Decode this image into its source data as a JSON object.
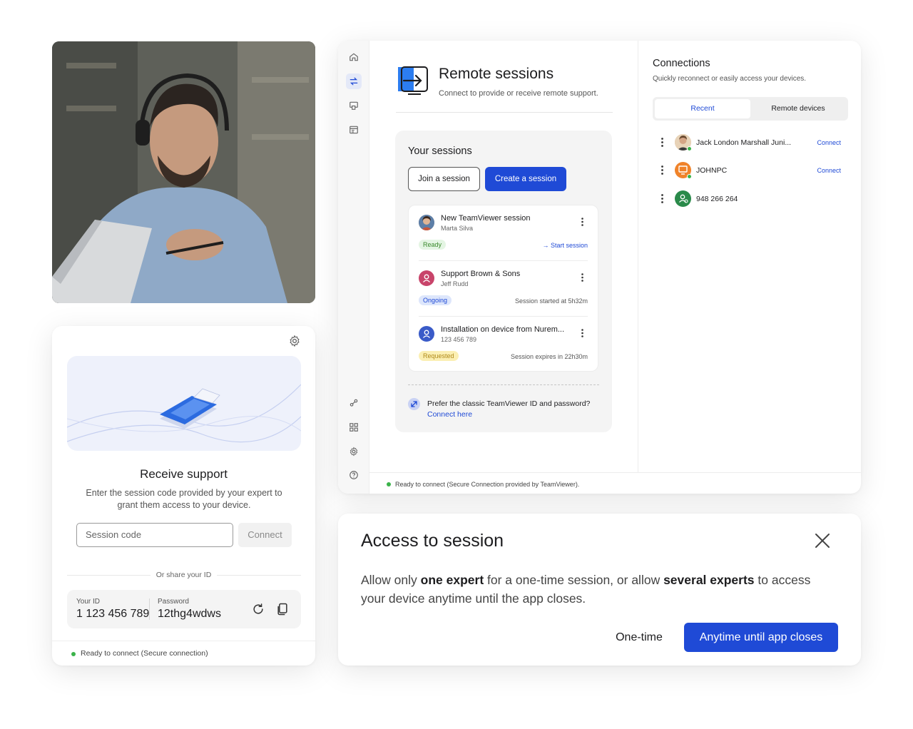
{
  "receive_support": {
    "title": "Receive support",
    "description": "Enter the session code provided by your expert to grant them access to your device.",
    "session_code_placeholder": "Session code",
    "connect_label": "Connect",
    "or_share": "Or share your ID",
    "your_id_label": "Your ID",
    "your_id_value": "1 123 456 789",
    "password_label": "Password",
    "password_value": "12thg4wdws",
    "status": "Ready to connect (Secure connection)"
  },
  "main": {
    "title": "Remote sessions",
    "subtitle": "Connect to provide or receive remote support.",
    "your_sessions": "Your sessions",
    "join_label": "Join a session",
    "create_label": "Create a session",
    "sessions": [
      {
        "name": "New TeamViewer session",
        "who": "Marta Silva",
        "badge": "Ready",
        "meta": "Start session"
      },
      {
        "name": "Support Brown & Sons",
        "who": "Jeff Rudd",
        "badge": "Ongoing",
        "meta": "Session started at 5h32m"
      },
      {
        "name": "Installation on device from Nurem...",
        "who": "123 456 789",
        "badge": "Requested",
        "meta": "Session expires in 22h30m"
      }
    ],
    "classic_text": "Prefer the classic TeamViewer ID and password?",
    "classic_link": "Connect here",
    "status": "Ready to connect (Secure Connection provided by TeamViewer)."
  },
  "connections": {
    "title": "Connections",
    "subtitle": "Quickly reconnect or easily access your devices.",
    "tab_recent": "Recent",
    "tab_remote": "Remote devices",
    "items": [
      {
        "name": "Jack London Marshall Juni...",
        "action": "Connect"
      },
      {
        "name": "JOHNPC",
        "action": "Connect"
      },
      {
        "name": "948 266 264",
        "action": ""
      }
    ]
  },
  "access": {
    "title": "Access to session",
    "text_1": "Allow only ",
    "text_bold_1": "one expert",
    "text_2": " for a one-time session, or allow ",
    "text_bold_2": "several experts",
    "text_3": " to access your device anytime until the app closes.",
    "one_time_label": "One-time",
    "anytime_label": "Anytime until app closes"
  },
  "colors": {
    "accent": "#1f4ad6",
    "ready": "#3bb34a",
    "ongoing": "#dde6fb",
    "requested": "#fbefb3"
  }
}
